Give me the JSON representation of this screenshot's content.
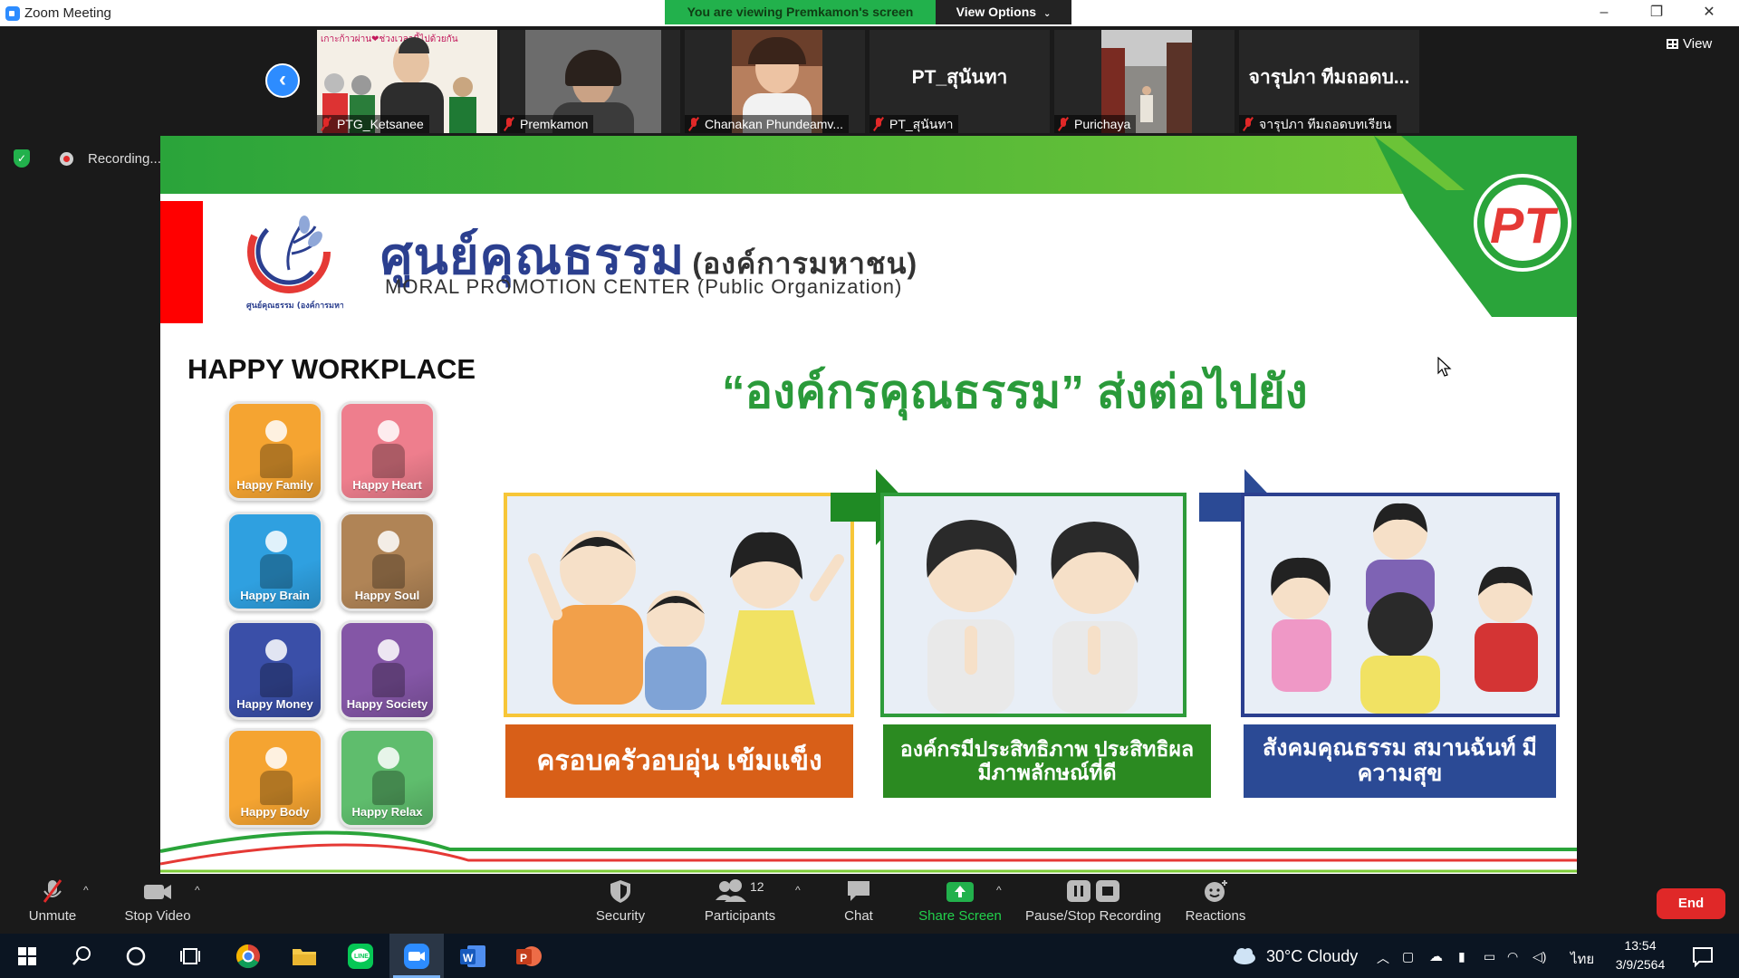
{
  "window": {
    "title": "Zoom Meeting",
    "banner": "You are viewing Premkamon's screen",
    "view_options": "View Options",
    "view_options_icon": "chevron-down-icon",
    "minimize": "–",
    "restore": "❐",
    "close": "✕"
  },
  "gallery": {
    "back_icon": "‹",
    "tiles": [
      {
        "name": "PTG_Ketsanee",
        "has_video": true,
        "video_caption": "เกาะก้าวผ่าน❤ช่วงเวลานี้ไปด้วยกัน"
      },
      {
        "name": "Premkamon",
        "has_video": true
      },
      {
        "name": "Chanakan Phundeamv...",
        "has_video": true
      },
      {
        "name": "PT_สุนันทา",
        "has_video": false,
        "display_name": "PT_สุนันทา"
      },
      {
        "name": "Purichaya",
        "has_video": true
      },
      {
        "name": "จารุปภา ทีมถอดบทเรียน",
        "has_video": false,
        "display_name": "จารุปภา ทีมถอดบ..."
      }
    ],
    "view_label": "View"
  },
  "recording": {
    "label": "Recording...",
    "pause_icon": "❚❚",
    "stop_icon": "■"
  },
  "slide": {
    "org_thai": "ศูนย์คุณธรรม",
    "org_thai_paren": "(องค์การมหาชน)",
    "org_en": "MORAL PROMOTION CENTER  (Public Organization)",
    "logo_caption": "ศูนย์คุณธรรม (องค์การมหาชน)",
    "pt_logo_text": "PT",
    "happy_workplace": "HAPPY WORKPLACE",
    "apps": [
      {
        "label": "Happy Family",
        "color": "#f5a431"
      },
      {
        "label": "Happy Heart",
        "color": "#ee7e8d"
      },
      {
        "label": "Happy Brain",
        "color": "#2fa0e0"
      },
      {
        "label": "Happy Soul",
        "color": "#b08456"
      },
      {
        "label": "Happy Money",
        "color": "#3a4fa8"
      },
      {
        "label": "Happy Society",
        "color": "#8456a6"
      },
      {
        "label": "Happy Body",
        "color": "#f5a431"
      },
      {
        "label": "Happy Relax",
        "color": "#5fbd6d"
      }
    ],
    "headline": "“องค์กรคุณธรรม” ส่งต่อไปยัง",
    "captions": [
      "ครอบครัวอบอุ่น เข้มแข็ง",
      "องค์กรมีประสิทธิภาพ ประสิทธิผล มีภาพลักษณ์ที่ดี",
      "สังคมคุณธรรม สมานฉันท์ มีความสุข"
    ]
  },
  "controls": {
    "unmute": "Unmute",
    "stop_video": "Stop Video",
    "security": "Security",
    "participants": "Participants",
    "participants_count": "12",
    "chat": "Chat",
    "share_screen": "Share Screen",
    "pause_stop_recording": "Pause/Stop Recording",
    "reactions": "Reactions",
    "end": "End",
    "caret": "^"
  },
  "taskbar": {
    "weather": "30°C  Cloudy",
    "language": "ไทย",
    "time": "13:54",
    "date": "3/9/2564"
  }
}
